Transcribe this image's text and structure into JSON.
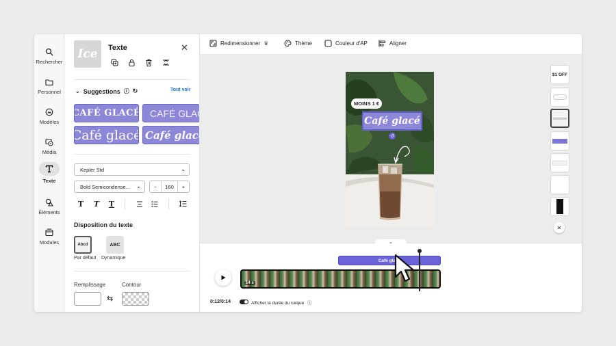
{
  "rail": {
    "items": [
      {
        "label": "Rechercher",
        "icon": "search-icon"
      },
      {
        "label": "Personnel",
        "icon": "folder-icon"
      },
      {
        "label": "Modèles",
        "icon": "templates-icon"
      },
      {
        "label": "Média",
        "icon": "media-icon"
      },
      {
        "label": "Texte",
        "icon": "text-icon",
        "active": true
      },
      {
        "label": "Éléments",
        "icon": "elements-icon"
      },
      {
        "label": "Modules",
        "icon": "modules-icon"
      }
    ]
  },
  "panel": {
    "thumb_text": "Ice",
    "title": "Texte",
    "suggestions_label": "Suggestions",
    "see_all": "Tout voir",
    "suggestions": [
      "CAFÉ GLACÉ",
      "CAFÉ GLACÉ",
      "Café glacé",
      "Café glacé"
    ],
    "font_family": "Kepler Std",
    "font_weight": "Bold Semicondense...",
    "font_size": "160",
    "layout_title": "Disposition du texte",
    "layout_options": [
      {
        "label": "Par défaut",
        "preview": "Abcd"
      },
      {
        "label": "Dynamique",
        "preview": "ABC"
      }
    ],
    "fill_label": "Remplissage",
    "outline_label": "Contour"
  },
  "toolbar": {
    "resize": "Redimensionner",
    "theme": "Thème",
    "bg_color": "Couleur d'AP",
    "align": "Aligner"
  },
  "canvas": {
    "badge": "MOINS 1 €",
    "headline": "Café glacé"
  },
  "pages": {
    "first_label": "$1 OFF"
  },
  "timeline": {
    "text_clip": "Café glacé",
    "clip_duration": "14 s",
    "timecode": "0:12/0:14",
    "show_duration": "Afficher la durée du calque"
  },
  "colors": {
    "accent": "#6a63d8",
    "chip": "#8d87d8"
  }
}
